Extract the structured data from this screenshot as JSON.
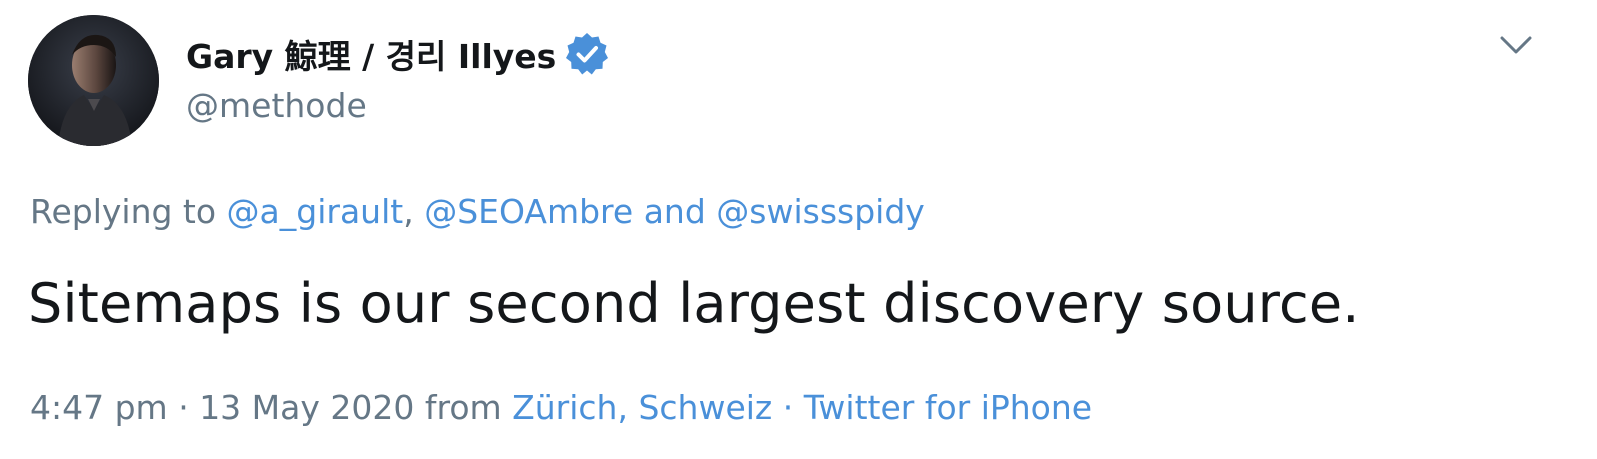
{
  "tweet": {
    "author": {
      "display_name": "Gary 鯨理 / 경리 Illyes",
      "handle": "@methode",
      "verified": true,
      "verified_icon": "verified-badge-icon"
    },
    "reply": {
      "prefix": "Replying to ",
      "mention_1": "@a_girault",
      "separator": ", ",
      "mention_2": "@SEOAmbre",
      "conjunction": " and ",
      "mention_3": "@swissspidy"
    },
    "text": "Sitemaps is our second largest discovery source.",
    "meta": {
      "time": "4:47 pm",
      "dot_1": " · ",
      "date": "13 May 2020",
      "from": " from ",
      "location": "Zürich, Schweiz",
      "dot_2": " · ",
      "source": "Twitter for iPhone"
    },
    "menu_icon": "chevron-down-icon"
  },
  "colors": {
    "text_primary": "#14171a",
    "text_secondary": "#657786",
    "link": "#4a90d9",
    "verified": "#4a90d9"
  }
}
